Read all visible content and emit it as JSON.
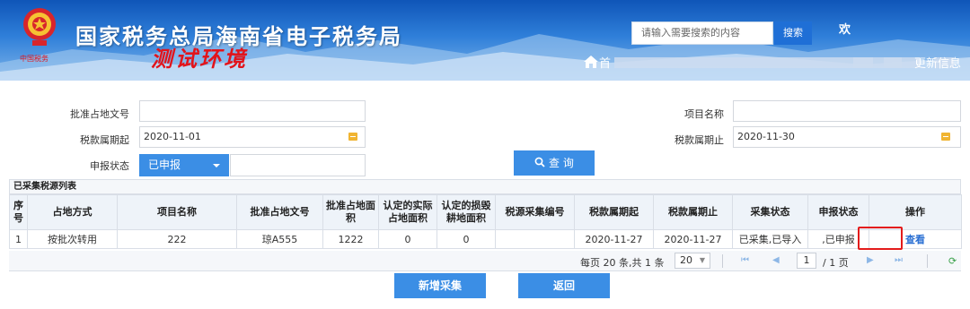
{
  "header": {
    "title": "国家税务总局海南省电子税务局",
    "env_label": "测试环境",
    "emblem_sub_text": "中国税务",
    "search_placeholder": "请输入需要搜索的内容",
    "search_button": "搜索",
    "user_name_partial": "欢",
    "nav_home": "首",
    "nav_update": "更新信息",
    "colors": {
      "banner": "#1f6fd6",
      "test_env": "#e2141b"
    }
  },
  "form": {
    "approval_no_label": "批准占地文号",
    "approval_no_value": "",
    "project_name_label": "项目名称",
    "project_name_value": "",
    "period_start_label": "税款属期起",
    "period_start_value": "2020-11-01",
    "period_end_label": "税款属期止",
    "period_end_value": "2020-11-30",
    "status_label": "申报状态",
    "status_value": "已申报",
    "query_button": "查 询",
    "query_icon": "search-icon"
  },
  "table": {
    "section_title": "已采集税源列表",
    "headers": [
      "序号",
      "占地方式",
      "项目名称",
      "批准占地文号",
      "批准占地面积",
      "认定的实际占地面积",
      "认定的损毁耕地面积",
      "税源采集编号",
      "税款属期起",
      "税款属期止",
      "采集状态",
      "申报状态",
      "操作"
    ],
    "rows": [
      [
        "1",
        "按批次转用",
        "222",
        "琼A555",
        "1222",
        "0",
        "0",
        "",
        "2020-11-27",
        "2020-11-27",
        "已采集,已导入",
        ",已申报",
        "查看"
      ]
    ],
    "highlight_color": "#e31b1b"
  },
  "pager": {
    "summary": "每页 20 条,共 1 条",
    "page_size": "20",
    "current_page": "1",
    "total_pages": "/ 1 页"
  },
  "actions": {
    "add_button": "新增采集",
    "back_button": "返回"
  }
}
